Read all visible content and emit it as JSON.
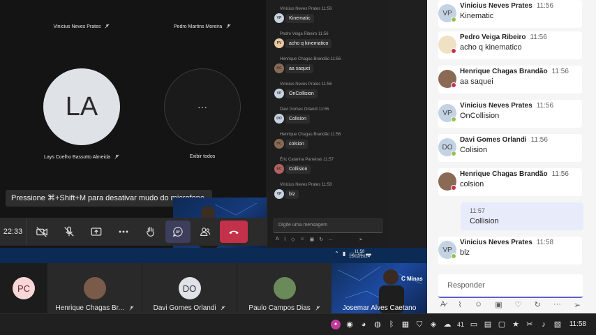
{
  "call": {
    "participants_top": [
      {
        "name": "Vinicius Neves Prates"
      },
      {
        "name": "Pedro Martins Moreira"
      }
    ],
    "participant_la": {
      "initials": "LA",
      "name": "Lays Coelho Bassotto Almeida"
    },
    "view_all": {
      "glyph": "···",
      "label": "Exibir todos"
    },
    "toast": "Pressione ⌘+Shift+M para desativar mudo do microfone.",
    "toolbar": {
      "clock": "22:33"
    }
  },
  "callchat": {
    "messages": [
      {
        "meta": "Vinicius Neves Prates  11:56",
        "initials": "VP",
        "text": "Kinematic"
      },
      {
        "meta": "Pedro Veiga Ribeiro  11:56",
        "initials": "PV",
        "text": "acho q kinematico"
      },
      {
        "meta": "Henrique Chagas Brandão  11:56",
        "initials": "HC",
        "text": "aa saquei"
      },
      {
        "meta": "Vinicius Neves Prates  11:56",
        "initials": "VP",
        "text": "OnCollision"
      },
      {
        "meta": "Davi Gomes Orlandi  11:56",
        "initials": "DO",
        "text": "Colision"
      },
      {
        "meta": "Henrique Chagas Brandão  11:56",
        "initials": "HC",
        "text": "colsion"
      },
      {
        "meta": "Éric Catarina Parreiras  11:57",
        "initials": "EC",
        "text": "Collision"
      },
      {
        "meta": "Vinicius Neves Prates  11:58",
        "initials": "VP",
        "text": "blz"
      }
    ],
    "input_placeholder": "Digite uma mensagem"
  },
  "inner_taskbar": {
    "time": "11:58",
    "date": "15/02/2024"
  },
  "strip": {
    "self": {
      "initials": "PC"
    },
    "participants": [
      {
        "name": "Henrique Chagas Br...",
        "initials": "HC",
        "photo": true
      },
      {
        "name": "Davi Gomes Orlandi",
        "initials": "DO",
        "photo": false
      },
      {
        "name": "Paulo Campos Dias",
        "initials": "PD",
        "photo": true
      }
    ],
    "video": {
      "name": "Josemar Alves Caetano",
      "overlay": "C Minas"
    }
  },
  "chat": {
    "messages": [
      {
        "initials": "VP",
        "author": "Vinicius Neves Prates",
        "time": "11:56",
        "text": "Kinematic",
        "status": "available"
      },
      {
        "initials": "PV",
        "author": "Pedro Veiga Ribeiro",
        "time": "11:56",
        "text": "acho q kinematico",
        "status": "busy"
      },
      {
        "initials": "HC",
        "author": "Henrique Chagas Brandão",
        "time": "11:56",
        "text": "aa saquei",
        "status": "busy"
      },
      {
        "initials": "VP",
        "author": "Vinicius Neves Prates",
        "time": "11:56",
        "text": "OnCollision",
        "status": "available"
      },
      {
        "initials": "DO",
        "author": "Davi Gomes Orlandi",
        "time": "11:56",
        "text": "Colision",
        "status": "available"
      },
      {
        "initials": "HC",
        "author": "Henrique Chagas Brandão",
        "time": "11:56",
        "text": "colsion",
        "status": "busy"
      },
      {
        "initials": "VP",
        "author": "Vinicius Neves Prates",
        "time": "11:58",
        "text": "blz",
        "status": "available"
      }
    ],
    "own_message": {
      "time": "11:57",
      "text": "Collision"
    },
    "reply_placeholder": "Responder"
  },
  "taskbar": {
    "tray_icons": [
      "obs-icon",
      "github-icon",
      "discord-icon",
      "steam-icon",
      "bluetooth-icon",
      "security-icon",
      "shield-icon",
      "gamepad-icon",
      "weather-icon",
      "display-icon",
      "printer-icon",
      "window-icon",
      "star-icon",
      "tools-icon",
      "music-icon",
      "clipboard-icon"
    ],
    "temperature": "41",
    "time": "11:58"
  },
  "colors": {
    "accent": "#5b5fc7",
    "leave": "#c4314b",
    "available": "#92c353",
    "busy": "#c4314b"
  }
}
